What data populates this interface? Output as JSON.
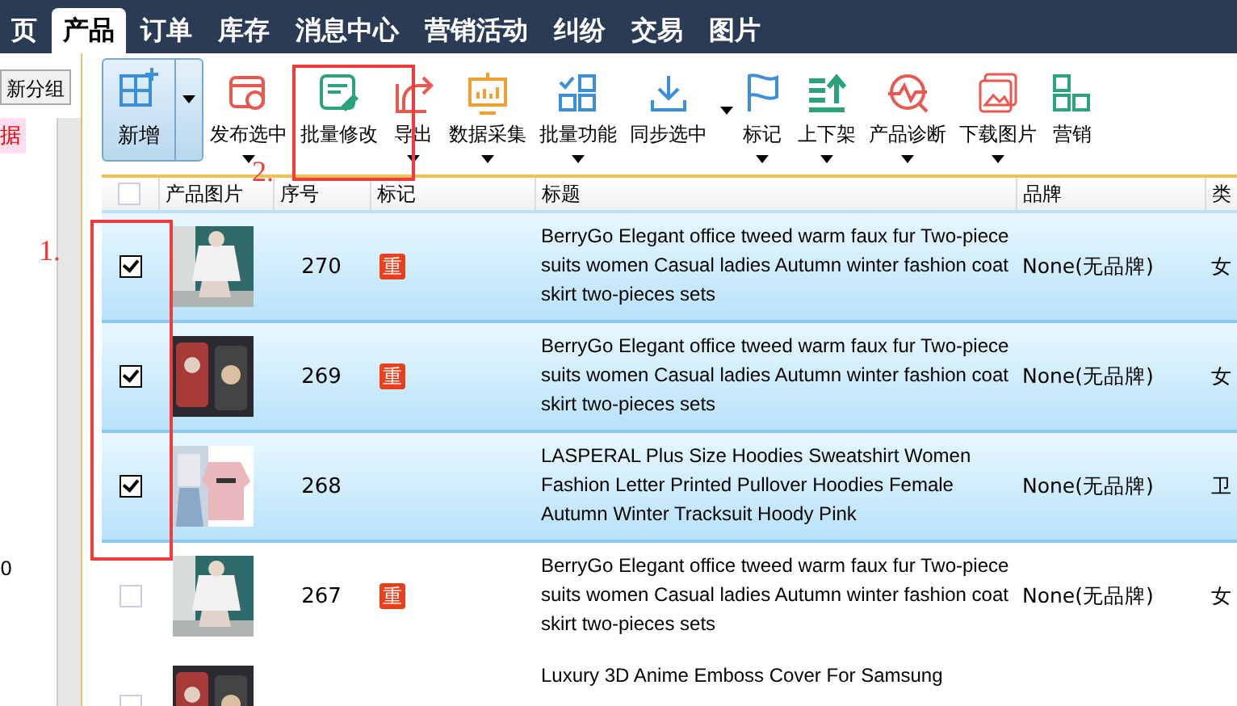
{
  "nav": {
    "tabs": [
      {
        "label": "页",
        "selected": false
      },
      {
        "label": "产品",
        "selected": true
      },
      {
        "label": "订单",
        "selected": false
      },
      {
        "label": "库存",
        "selected": false
      },
      {
        "label": "消息中心",
        "selected": false
      },
      {
        "label": "营销活动",
        "selected": false
      },
      {
        "label": "纠纷",
        "selected": false
      },
      {
        "label": "交易",
        "selected": false
      },
      {
        "label": "图片",
        "selected": false
      }
    ]
  },
  "sidebar": {
    "button": "新分组",
    "item": "据",
    "number": "0"
  },
  "toolbar": [
    {
      "label": "新增",
      "kind": "split"
    },
    {
      "label": "发布选中",
      "kind": "dropdown"
    },
    {
      "label": "批量修改",
      "kind": "plain"
    },
    {
      "label": "导出",
      "kind": "dropdown"
    },
    {
      "label": "数据采集",
      "kind": "dropdown"
    },
    {
      "label": "批量功能",
      "kind": "dropdown"
    },
    {
      "label": "同步选中",
      "kind": "side"
    },
    {
      "label": "标记",
      "kind": "dropdown"
    },
    {
      "label": "上下架",
      "kind": "dropdown"
    },
    {
      "label": "产品诊断",
      "kind": "dropdown"
    },
    {
      "label": "下载图片",
      "kind": "dropdown"
    },
    {
      "label": "营销",
      "kind": "plain"
    }
  ],
  "table": {
    "columns": [
      "产品图片",
      "序号",
      "标记",
      "标题",
      "品牌",
      "类"
    ],
    "header_checked": false,
    "rows": [
      {
        "checked": true,
        "selected": true,
        "number": "270",
        "mark": "重",
        "title": "BerryGo Elegant office tweed warm faux fur Two-piece suits women Casual ladies Autumn winter fashion coat skirt two-pieces sets",
        "brand": "None(无品牌)",
        "category": "女"
      },
      {
        "checked": true,
        "selected": true,
        "number": "269",
        "mark": "重",
        "title": "BerryGo Elegant office tweed warm faux fur Two-piece suits women Casual ladies Autumn winter fashion coat skirt two-pieces sets",
        "brand": "None(无品牌)",
        "category": "女"
      },
      {
        "checked": true,
        "selected": true,
        "number": "268",
        "title": "LASPERAL Plus Size Hoodies Sweatshirt Women Fashion Letter Printed Pullover Hoodies Female Autumn Winter Tracksuit Hoody Pink",
        "brand": "None(无品牌)",
        "category": "卫"
      },
      {
        "checked": false,
        "selected": false,
        "number": "267",
        "mark": "重",
        "title": "BerryGo Elegant office tweed warm faux fur Two-piece suits women Casual ladies Autumn winter fashion coat skirt two-pieces sets",
        "brand": "None(无品牌)",
        "category": "女"
      },
      {
        "checked": false,
        "selected": false,
        "title": "Luxury 3D Anime Emboss Cover For Samsung"
      }
    ]
  },
  "annotations": [
    {
      "label": "1."
    },
    {
      "label": "2."
    }
  ]
}
